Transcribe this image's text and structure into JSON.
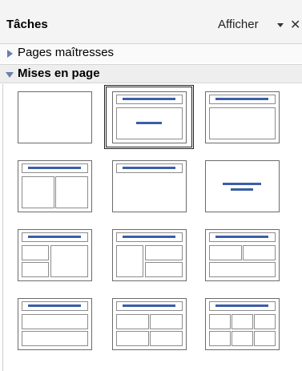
{
  "panel": {
    "title": "Tâches",
    "view_label": "Afficher",
    "close_label": "✕"
  },
  "sections": {
    "masters_label": "Pages maîtresses",
    "layouts_label": "Mises en page"
  },
  "layouts": {
    "selected_index": 1,
    "tiles": [
      {
        "id": "blank"
      },
      {
        "id": "title-slide"
      },
      {
        "id": "title-content"
      },
      {
        "id": "title-two-content"
      },
      {
        "id": "title-only"
      },
      {
        "id": "centered-text"
      },
      {
        "id": "title-two-left-one-right"
      },
      {
        "id": "title-one-left-two-right"
      },
      {
        "id": "title-two-top-one-bottom"
      },
      {
        "id": "title-two-stacked"
      },
      {
        "id": "title-four-content"
      },
      {
        "id": "title-six-content"
      }
    ]
  },
  "colors": {
    "accent_bar": "#3b5ea6",
    "frame": "#6b6b6b",
    "box": "#8c8c8c"
  }
}
